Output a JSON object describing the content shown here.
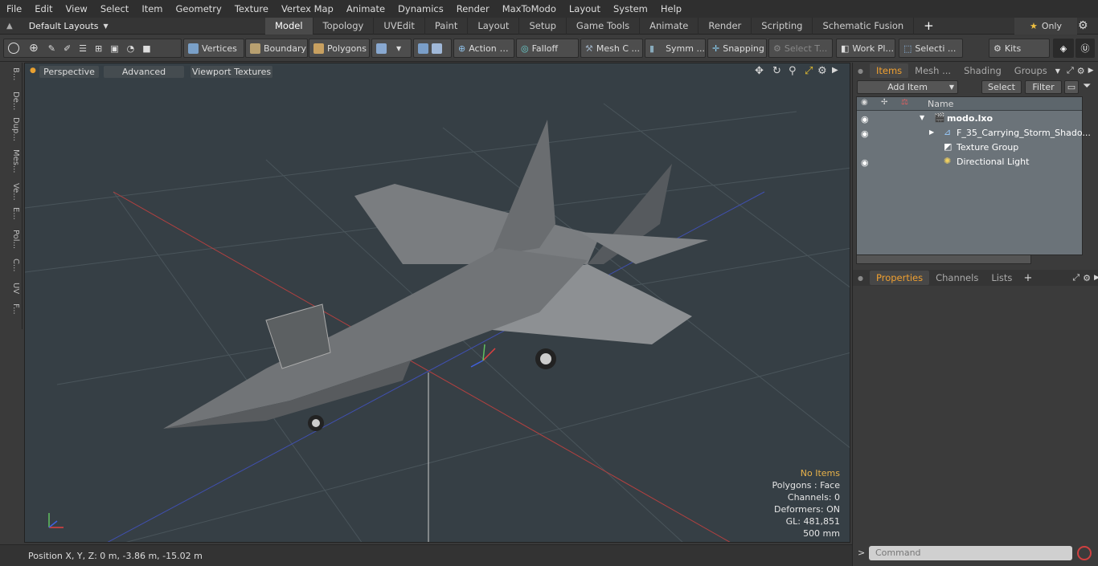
{
  "menu": [
    "File",
    "Edit",
    "View",
    "Select",
    "Item",
    "Geometry",
    "Texture",
    "Vertex Map",
    "Animate",
    "Dynamics",
    "Render",
    "MaxToModo",
    "Layout",
    "System",
    "Help"
  ],
  "layout_selector": "Default Layouts",
  "layout_tabs": [
    {
      "label": "Model",
      "active": true
    },
    {
      "label": "Topology"
    },
    {
      "label": "UVEdit"
    },
    {
      "label": "Paint"
    },
    {
      "label": "Layout"
    },
    {
      "label": "Setup"
    },
    {
      "label": "Game Tools"
    },
    {
      "label": "Animate"
    },
    {
      "label": "Render"
    },
    {
      "label": "Scripting"
    },
    {
      "label": "Schematic Fusion"
    }
  ],
  "only_label": "Only",
  "toolbar": {
    "vertices": "Vertices",
    "boundary": "Boundary",
    "polygons": "Polygons",
    "action": "Action",
    "falloff": "Falloff",
    "mesh": "Mesh C ...",
    "symmetry": "Symm ...",
    "snapping": "Snapping",
    "select_t": "Select T...",
    "work_plane": "Work Pl...",
    "selection": "Selecti ...",
    "kits": "Kits"
  },
  "left_tabs": [
    "B...",
    "De...",
    "Dup...",
    "Mes...",
    "Ve...",
    "E...",
    "Pol...",
    "C...",
    "UV",
    "F..."
  ],
  "viewport": {
    "perspective": "Perspective",
    "advanced": "Advanced",
    "viewport_textures": "Viewport Textures",
    "info": {
      "no_items": "No Items",
      "polygons": "Polygons : Face",
      "channels": "Channels: 0",
      "deformers": "Deformers: ON",
      "gl": "GL: 481,851",
      "grid": "500 mm"
    }
  },
  "status": {
    "position": "Position X, Y, Z:   0 m, -3.86 m, -15.02 m"
  },
  "items_panel": {
    "tabs": [
      "Items",
      "Mesh ...",
      "Shading",
      "Groups"
    ],
    "add_item": "Add Item",
    "select": "Select",
    "filter": "Filter",
    "name_col": "Name",
    "tree": [
      {
        "label": "modo.lxo",
        "indent": 0
      },
      {
        "label": "F_35_Carrying_Storm_Shado...",
        "indent": 1
      },
      {
        "label": "Texture Group",
        "indent": 1
      },
      {
        "label": "Directional Light",
        "indent": 1
      }
    ]
  },
  "properties_panel": {
    "tabs": [
      "Properties",
      "Channels",
      "Lists"
    ]
  },
  "command_placeholder": "Command",
  "colors": {
    "accent": "#f0a030",
    "viewport_bg": "#363f45",
    "tree_bg": "#6b7379"
  }
}
